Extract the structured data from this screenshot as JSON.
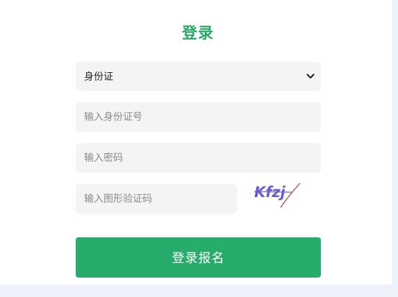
{
  "login": {
    "title": "登录",
    "id_type_selected": "身份证",
    "id_number_placeholder": "输入身份证号",
    "password_placeholder": "输入密码",
    "captcha_placeholder": "输入图形验证码",
    "captcha_text": "Kfzj",
    "submit_label": "登录报名"
  },
  "colors": {
    "accent": "#27ac6b",
    "title": "#27a867",
    "field_bg": "#f4f4f4",
    "page_bg": "#eef3fb",
    "captcha_text": "#6a5acd",
    "captcha_line": "#b03050"
  }
}
